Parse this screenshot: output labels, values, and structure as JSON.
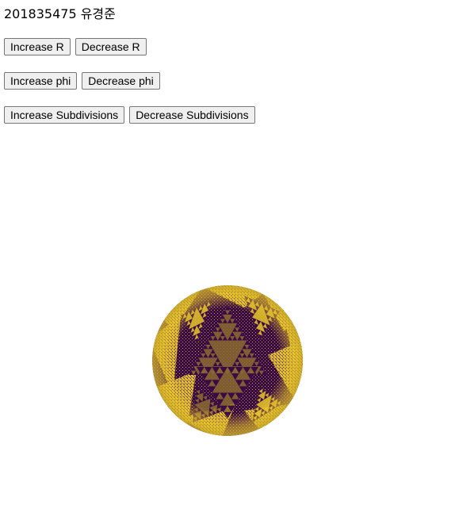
{
  "header": {
    "title": "201835475 유경준"
  },
  "controls": {
    "increase_r_label": "Increase R",
    "decrease_r_label": "Decrease R",
    "increase_phi_label": "Increase phi",
    "decrease_phi_label": "Decrease phi",
    "increase_subdivisions_label": "Increase Subdivisions",
    "decrease_subdivisions_label": "Decrease Subdivisions"
  },
  "render": {
    "colors": {
      "dark": "#3a0a46",
      "bright": "#e8c52a",
      "mid": "#8c6a30",
      "background": "#ffffff"
    }
  }
}
